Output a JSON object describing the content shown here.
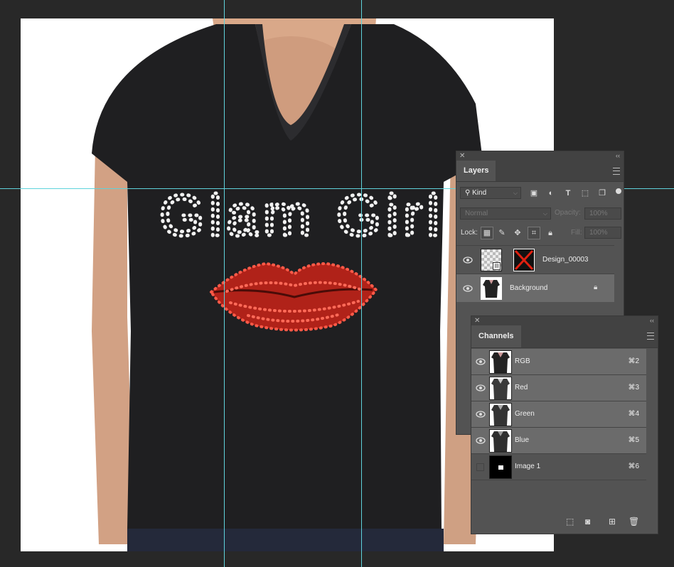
{
  "canvas": {
    "shirt_text": "Glam Girl"
  },
  "layers_panel": {
    "tab": "Layers",
    "filter_kind": "Kind",
    "blend_mode": "Normal",
    "opacity_label": "Opacity:",
    "opacity_value": "100%",
    "lock_label": "Lock:",
    "fill_label": "Fill:",
    "fill_value": "100%",
    "layers": [
      {
        "name": "Design_00003"
      },
      {
        "name": "Background"
      }
    ]
  },
  "channels_panel": {
    "tab": "Channels",
    "channels": [
      {
        "name": "RGB",
        "shortcut": "⌘2"
      },
      {
        "name": "Red",
        "shortcut": "⌘3"
      },
      {
        "name": "Green",
        "shortcut": "⌘4"
      },
      {
        "name": "Blue",
        "shortcut": "⌘5"
      },
      {
        "name": "Image 1",
        "shortcut": "⌘6"
      }
    ]
  },
  "colors": {
    "guide": "#5fd3dc",
    "panel": "#535353",
    "lips": "#c0261c",
    "shirt": "#1f1f21"
  }
}
